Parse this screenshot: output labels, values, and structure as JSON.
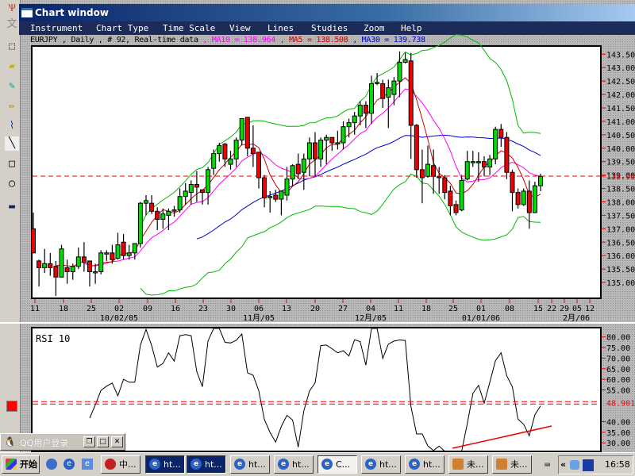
{
  "window": {
    "title": "Chart window"
  },
  "menu": [
    "Instrument",
    "Chart Type",
    "Time Scale",
    "View",
    "Lines",
    "Studies",
    "Zoom",
    "Help"
  ],
  "info": {
    "symbol": "EURJPY , Daily , # 92, Real-time data",
    "ma10_label": ", MA10 = 138.964",
    "ma5_label": ", MA5 = 138.508",
    "ma30_label": ", MA30 = 139.738",
    "ma10_color": "#ff00ff",
    "ma5_color": "#cc0000",
    "ma30_color": "#0000cc"
  },
  "colors": {
    "up": "#00dd00",
    "down": "#ee0000",
    "bollinger": "#00bb00",
    "dashed": "#ee0000"
  },
  "price_axis": {
    "ticks": [
      "143.50",
      "143.00",
      "142.50",
      "142.00",
      "141.50",
      "141.00",
      "140.50",
      "140.00",
      "139.50",
      "139.00",
      "138.50",
      "138.00",
      "137.50",
      "137.00",
      "136.50",
      "136.00",
      "135.50",
      "135.00"
    ],
    "current": "138.96"
  },
  "date_axis": {
    "days": [
      "11",
      "18",
      "25",
      "02",
      "09",
      "16",
      "23",
      "30",
      "06",
      "13",
      "20",
      "27",
      "04",
      "11",
      "18",
      "25",
      "01",
      "08",
      "15",
      "22",
      "29",
      "05",
      "12"
    ],
    "months": [
      "10/02/05",
      "11月/05",
      "12月/05",
      "01/01/06",
      "2月/06"
    ]
  },
  "rsi": {
    "label": "RSI 10",
    "ticks": [
      "80.00",
      "75.00",
      "70.00",
      "65.00",
      "60.00",
      "55.00",
      "40.00",
      "35.00",
      "30.00"
    ],
    "current": "48.901",
    "trendline_color": "#ee0000"
  },
  "chart_data": {
    "type": "candlestick",
    "symbol": "EURJPY",
    "period": "Daily",
    "ylim": [
      135,
      143.5
    ],
    "ohlc": [
      [
        137.0,
        137.6,
        136.1,
        136.1
      ],
      [
        135.8,
        135.85,
        134.85,
        135.55
      ],
      [
        135.55,
        136.25,
        135.35,
        135.7
      ],
      [
        135.7,
        136.1,
        135.25,
        135.55
      ],
      [
        135.6,
        135.8,
        134.5,
        135.2
      ],
      [
        135.2,
        136.4,
        135.2,
        136.25
      ],
      [
        135.55,
        135.85,
        134.95,
        135.4
      ],
      [
        135.4,
        135.7,
        135.1,
        135.6
      ],
      [
        135.6,
        136.3,
        135.5,
        135.95
      ],
      [
        135.95,
        136.5,
        135.4,
        135.75
      ],
      [
        135.8,
        135.8,
        134.85,
        135.4
      ],
      [
        135.4,
        135.7,
        134.95,
        135.4
      ],
      [
        135.4,
        136.2,
        135.3,
        136.1
      ],
      [
        136.1,
        136.2,
        135.8,
        136.1
      ],
      [
        136.1,
        136.4,
        135.7,
        135.85
      ],
      [
        135.9,
        136.85,
        135.85,
        136.4
      ],
      [
        136.5,
        136.8,
        135.85,
        136.0
      ],
      [
        136.0,
        136.4,
        135.85,
        136.1
      ],
      [
        136.1,
        136.45,
        135.85,
        136.45
      ],
      [
        136.45,
        138.0,
        136.3,
        137.95
      ],
      [
        137.95,
        138.25,
        137.5,
        138.05
      ],
      [
        137.95,
        138.25,
        137.55,
        137.65
      ],
      [
        137.65,
        137.8,
        136.95,
        137.35
      ],
      [
        137.35,
        137.75,
        137.0,
        137.55
      ],
      [
        137.5,
        137.75,
        136.95,
        137.65
      ],
      [
        137.7,
        137.85,
        137.45,
        137.7
      ],
      [
        137.7,
        138.5,
        137.6,
        138.2
      ],
      [
        138.2,
        138.7,
        137.9,
        138.4
      ],
      [
        138.35,
        138.8,
        137.9,
        138.65
      ],
      [
        138.65,
        139.15,
        138.0,
        138.55
      ],
      [
        138.45,
        138.45,
        137.9,
        138.35
      ],
      [
        138.35,
        139.3,
        137.9,
        139.2
      ],
      [
        139.25,
        139.95,
        139.0,
        139.8
      ],
      [
        139.8,
        140.2,
        139.5,
        140.1
      ],
      [
        140.15,
        140.2,
        139.3,
        139.6
      ],
      [
        139.4,
        139.9,
        139.2,
        139.6
      ],
      [
        139.6,
        140.4,
        139.3,
        140.3
      ],
      [
        140.3,
        141.1,
        140.1,
        141.1
      ],
      [
        141.15,
        141.15,
        139.7,
        140.0
      ],
      [
        140.0,
        140.85,
        139.3,
        139.8
      ],
      [
        139.85,
        139.85,
        138.5,
        138.9
      ],
      [
        138.9,
        139.0,
        137.8,
        138.15
      ],
      [
        138.2,
        138.4,
        137.6,
        138.2
      ],
      [
        138.25,
        138.45,
        138.0,
        138.1
      ],
      [
        138.1,
        138.4,
        137.5,
        138.4
      ],
      [
        138.25,
        139.3,
        138.05,
        138.85
      ],
      [
        138.85,
        139.4,
        138.6,
        139.35
      ],
      [
        139.4,
        139.8,
        138.85,
        139.05
      ],
      [
        139.1,
        139.8,
        138.45,
        139.6
      ],
      [
        139.6,
        140.4,
        138.95,
        140.2
      ],
      [
        140.2,
        140.6,
        138.95,
        139.6
      ],
      [
        139.6,
        140.4,
        139.3,
        140.3
      ],
      [
        140.3,
        140.5,
        139.4,
        140.4
      ],
      [
        140.4,
        140.4,
        139.9,
        140.2
      ],
      [
        140.2,
        140.65,
        139.95,
        140.2
      ],
      [
        140.2,
        141.0,
        139.95,
        140.8
      ],
      [
        140.8,
        141.1,
        140.4,
        140.95
      ],
      [
        140.95,
        141.35,
        140.5,
        141.2
      ],
      [
        141.2,
        141.75,
        140.85,
        141.6
      ],
      [
        141.6,
        141.75,
        140.75,
        141.3
      ],
      [
        141.3,
        142.7,
        140.9,
        142.4
      ],
      [
        142.45,
        142.8,
        142.35,
        142.45
      ],
      [
        142.4,
        142.55,
        141.5,
        141.85
      ],
      [
        141.9,
        142.55,
        140.75,
        142.25
      ],
      [
        142.0,
        142.65,
        141.6,
        142.5
      ],
      [
        142.5,
        143.6,
        141.9,
        143.2
      ],
      [
        143.2,
        143.55,
        143.15,
        143.3
      ],
      [
        143.25,
        143.55,
        139.6,
        140.85
      ],
      [
        140.85,
        140.9,
        138.9,
        139.2
      ],
      [
        139.2,
        139.95,
        137.95,
        138.9
      ],
      [
        138.95,
        140.1,
        138.9,
        139.4
      ],
      [
        139.35,
        139.95,
        138.3,
        138.95
      ],
      [
        138.95,
        139.3,
        138.3,
        138.9
      ],
      [
        138.9,
        139.0,
        138.1,
        138.35
      ],
      [
        138.4,
        138.6,
        137.5,
        137.85
      ],
      [
        137.9,
        138.05,
        137.5,
        137.6
      ],
      [
        137.7,
        139.0,
        137.65,
        138.8
      ],
      [
        138.85,
        139.9,
        138.8,
        139.5
      ],
      [
        139.5,
        139.9,
        139.3,
        139.5
      ],
      [
        139.5,
        139.85,
        138.75,
        139.5
      ],
      [
        139.5,
        139.7,
        138.95,
        139.3
      ],
      [
        139.3,
        139.75,
        139.0,
        139.6
      ],
      [
        139.6,
        140.8,
        139.4,
        140.7
      ],
      [
        140.7,
        140.9,
        140.05,
        140.4
      ],
      [
        140.4,
        140.6,
        138.85,
        139.1
      ],
      [
        139.1,
        139.2,
        137.65,
        138.35
      ],
      [
        138.35,
        138.5,
        137.75,
        137.9
      ],
      [
        137.9,
        138.5,
        137.85,
        138.4
      ],
      [
        138.4,
        138.8,
        137.0,
        137.6
      ],
      [
        137.6,
        138.75,
        137.6,
        138.6
      ],
      [
        138.6,
        139.05,
        138.4,
        138.95
      ]
    ],
    "indicators": [
      "MA5",
      "MA10",
      "MA30",
      "Bollinger 20",
      "RSI 10"
    ],
    "rsi_ylim": [
      30,
      80
    ]
  },
  "qq": {
    "title": "QQ用户登录"
  },
  "taskbar": {
    "start": "开始",
    "buttons": [
      "中...",
      "ht...",
      "ht...",
      "ht...",
      "ht...",
      "C...",
      "ht...",
      "ht...",
      "未...",
      "未..."
    ],
    "clock": "16:58"
  }
}
